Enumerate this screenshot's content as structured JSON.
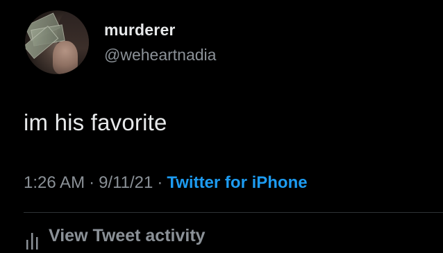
{
  "user": {
    "display_name": "murderer",
    "handle": "@weheartnadia",
    "avatar_icon": "profile-avatar"
  },
  "tweet": {
    "text": "im his favorite"
  },
  "meta": {
    "time": "1:26 AM",
    "date": "9/11/21",
    "separator": "·",
    "source": "Twitter for iPhone"
  },
  "actions": {
    "view_activity_label": "View Tweet activity",
    "view_activity_icon": "bar-chart-icon"
  },
  "colors": {
    "background": "#000000",
    "primary_text": "#e7e9ea",
    "secondary_text": "#8b9197",
    "accent": "#1d9bf0",
    "divider": "#2f3336"
  }
}
